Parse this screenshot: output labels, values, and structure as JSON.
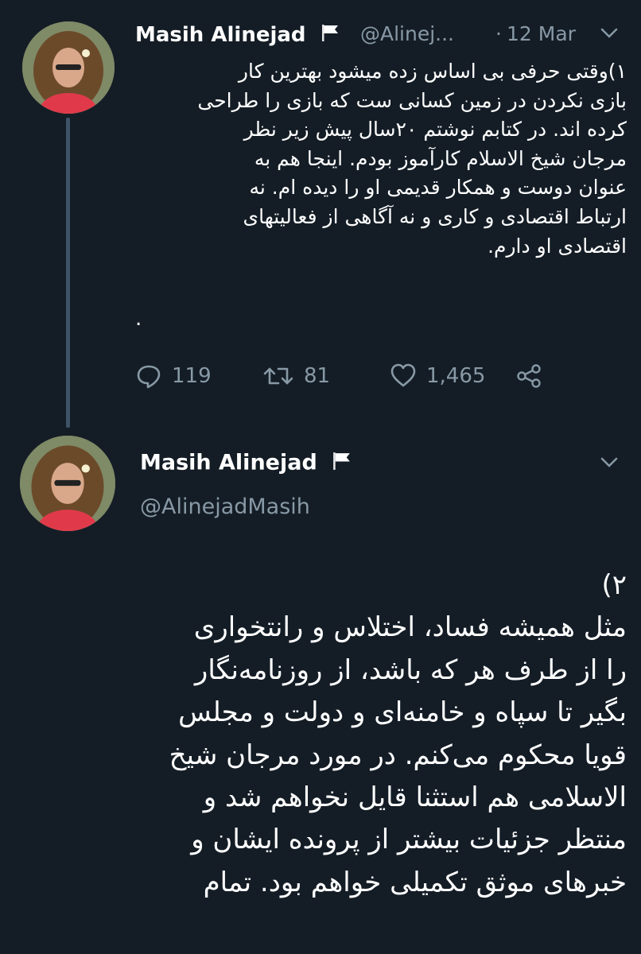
{
  "tweet1": {
    "author_name": "Masih Alinejad",
    "handle": "@Alinej...",
    "separator": "·",
    "date": "12 Mar",
    "text_lines": [
      "۱)وقتی حرفی بی اساس زده میشود بهترین کار",
      "بازی نکردن در زمین کسانی ست که بازی را طراحی",
      "کرده اند. در کتابم نوشتم ۲۰سال پیش زیر نظر",
      "مرجان شیخ الاسلام کارآموز بودم. اینجا هم به",
      "عنوان دوست و همکار قدیمی او را دیده ام. نه",
      "ارتباط اقتصادی و کاری و نه آگاهی از فعالیتهای",
      "اقتصادی او دارم."
    ],
    "trailing_dot": ".",
    "replies": "119",
    "retweets": "81",
    "likes": "1,465"
  },
  "tweet2": {
    "author_name": "Masih Alinejad",
    "handle": "@AlinejadMasih",
    "text_lines": [
      "۲)",
      "مثل همیشه فساد، اختلاس و رانتخواری",
      "را از طرف هر که باشد، از روزنامه‌نگار",
      "بگیر تا سپاه و خامنه‌ای و دولت و مجلس",
      "قویا محکوم می‌کنم. در مورد مرجان شیخ",
      "الاسلامی هم استثنا قایل نخواهم شد و",
      "منتظر جزئیات بیشتر از پرونده ایشان و",
      "خبرهای موثق تکمیلی خواهم بود. تمام"
    ]
  },
  "icons": {
    "flag": "white-flag-icon",
    "chevron": "chevron-down-icon",
    "reply": "reply-icon",
    "retweet": "retweet-icon",
    "like": "heart-icon",
    "share": "share-icon"
  },
  "colors": {
    "background": "#141d26",
    "secondary_text": "#8899a6",
    "thread_line": "#3d5466"
  }
}
